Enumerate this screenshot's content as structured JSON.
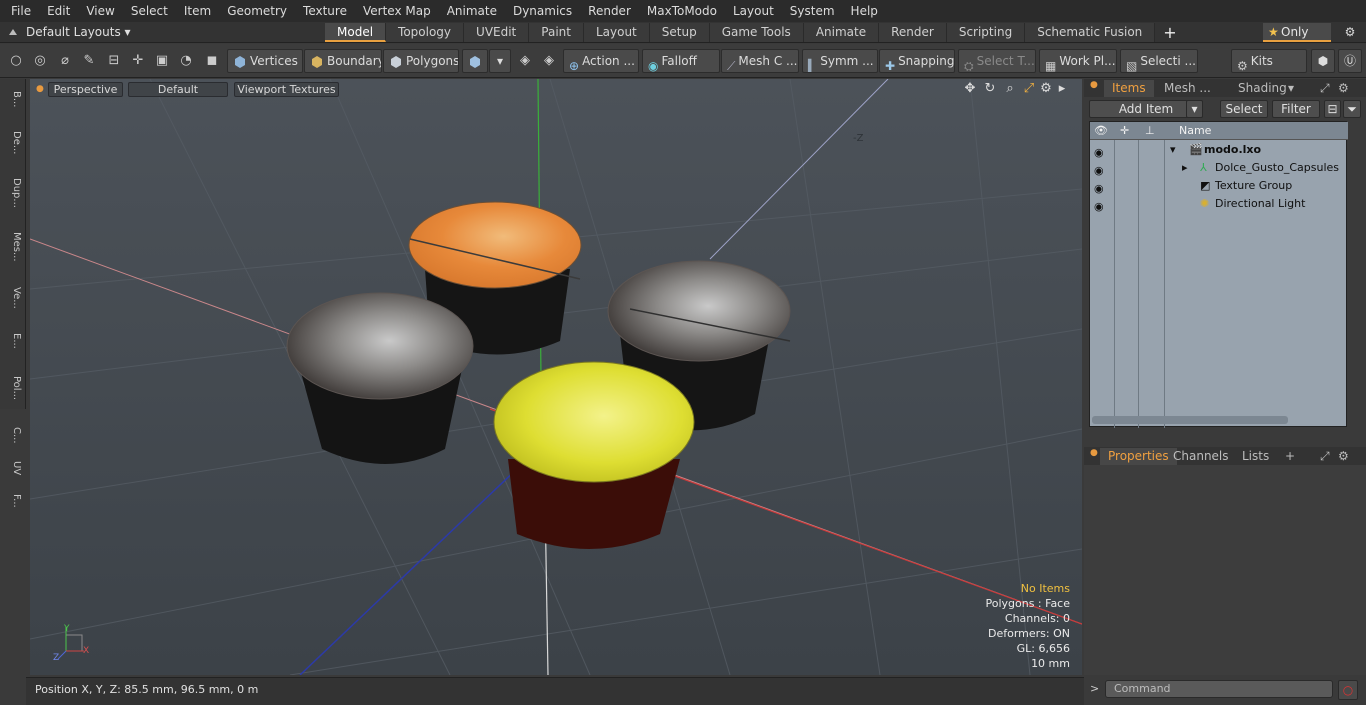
{
  "menu": [
    "File",
    "Edit",
    "View",
    "Select",
    "Item",
    "Geometry",
    "Texture",
    "Vertex Map",
    "Animate",
    "Dynamics",
    "Render",
    "MaxToModo",
    "Layout",
    "System",
    "Help"
  ],
  "layout_selector": "Default Layouts",
  "tabs": [
    "Model",
    "Topology",
    "UVEdit",
    "Paint",
    "Layout",
    "Setup",
    "Game Tools",
    "Animate",
    "Render",
    "Scripting",
    "Schematic Fusion"
  ],
  "active_tab": "Model",
  "only_label": "Only",
  "toolbar": {
    "vertices": "Vertices",
    "boundary": "Boundary",
    "polygons": "Polygons",
    "action": "Action ...",
    "falloff": "Falloff",
    "mesh": "Mesh C ...",
    "symm": "Symm ...",
    "snapping": "Snapping",
    "select_t": "Select T...",
    "work_pl": "Work Pl...",
    "selecti": "Selecti ...",
    "kits": "Kits"
  },
  "left_tabs": [
    "B...",
    "De...",
    "Dup...",
    "Mes...",
    "Ve...",
    "E...",
    "Pol...",
    "C...",
    "UV",
    "F..."
  ],
  "viewport": {
    "perspective": "Perspective",
    "default": "Default",
    "textures": "Viewport Textures",
    "axis_label": "-Z",
    "gizmo_x": "X",
    "gizmo_y": "Y",
    "gizmo_z": "Z",
    "stats": {
      "no_items": "No Items",
      "polygons": "Polygons : Face",
      "channels": "Channels: 0",
      "deformers": "Deformers: ON",
      "gl": "GL: 6,656",
      "scale": "10 mm"
    }
  },
  "status": "Position X, Y, Z:   85.5 mm, 96.5 mm, 0 m",
  "panel": {
    "tabs": [
      "Items",
      "Mesh ...",
      "Shading"
    ],
    "add_item": "Add Item",
    "select": "Select",
    "filter": "Filter",
    "name_header": "Name",
    "items": [
      {
        "name": "modo.lxo"
      },
      {
        "name": "Dolce_Gusto_Capsules"
      },
      {
        "name": "Texture Group"
      },
      {
        "name": "Directional Light"
      }
    ],
    "props_tabs": [
      "Properties",
      "Channels",
      "Lists"
    ],
    "command_placeholder": "Command"
  },
  "colors": {
    "accent": "#e8a040",
    "viewport_bg": "#4a5058",
    "tree_bg": "#98a3ae"
  }
}
